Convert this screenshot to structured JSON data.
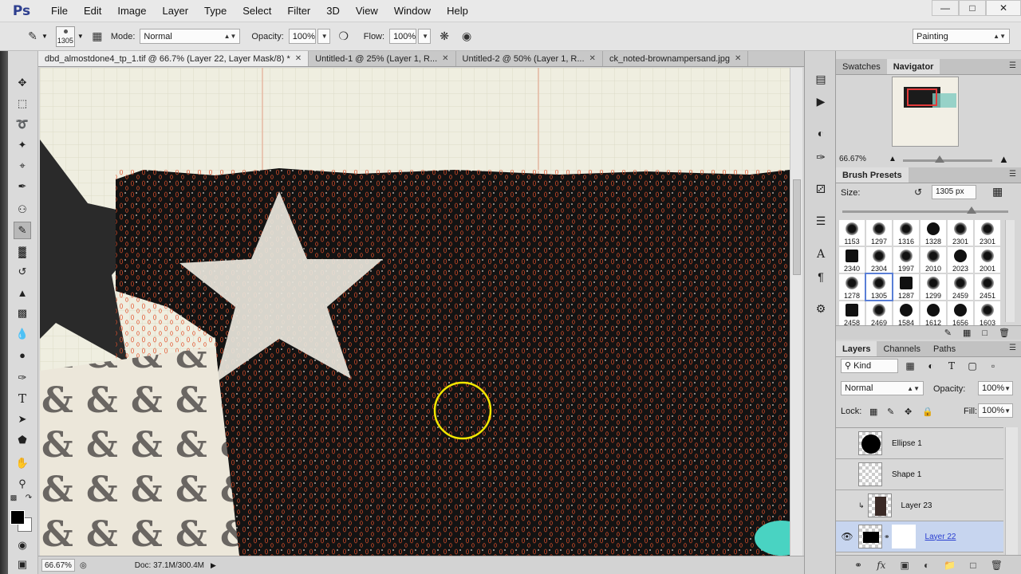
{
  "app": {
    "logo": "Ps",
    "menu": [
      "File",
      "Edit",
      "Image",
      "Layer",
      "Type",
      "Select",
      "Filter",
      "3D",
      "View",
      "Window",
      "Help"
    ],
    "window_controls": [
      "minimize-icon",
      "maximize-icon",
      "close-icon"
    ]
  },
  "options_bar": {
    "brush_size": "1305",
    "mode_label": "Mode:",
    "mode_value": "Normal",
    "opacity_label": "Opacity:",
    "opacity_value": "100%",
    "flow_label": "Flow:",
    "flow_value": "100%",
    "workspace_value": "Painting"
  },
  "tabs": [
    {
      "label": "dbd_almostdone4_tp_1.tif @ 66.7% (Layer 22, Layer Mask/8) *",
      "active": true
    },
    {
      "label": "Untitled-1 @ 25% (Layer 1, R...",
      "active": false
    },
    {
      "label": "Untitled-2 @ 50% (Layer 1, R...",
      "active": false
    },
    {
      "label": "ck_noted-brownampersand.jpg",
      "active": false
    }
  ],
  "status_bar": {
    "zoom": "66.67%",
    "doc": "Doc: 37.1M/300.4M"
  },
  "navigator": {
    "tabs": [
      "Swatches",
      "Navigator"
    ],
    "zoom": "66.67%"
  },
  "brush_presets": {
    "title": "Brush Presets",
    "size_label": "Size:",
    "size_value": "1305 px",
    "presets": [
      "1153",
      "1297",
      "1316",
      "1328",
      "2301",
      "2301",
      "2340",
      "2304",
      "1997",
      "2010",
      "2023",
      "2001",
      "1278",
      "1305",
      "1287",
      "1299",
      "2459",
      "2451",
      "2458",
      "2469",
      "1584",
      "1612",
      "1656",
      "1603"
    ]
  },
  "layers": {
    "tabs": [
      "Layers",
      "Channels",
      "Paths"
    ],
    "kind_label": "Kind",
    "blend_mode": "Normal",
    "opacity_label": "Opacity:",
    "opacity_value": "100%",
    "lock_label": "Lock:",
    "fill_label": "Fill:",
    "fill_value": "100%",
    "items": [
      {
        "name": "Ellipse 1",
        "visible": false,
        "selected": false
      },
      {
        "name": "Shape 1",
        "visible": false,
        "selected": false
      },
      {
        "name": "Layer 23",
        "visible": false,
        "selected": false
      },
      {
        "name": "Layer 22",
        "visible": true,
        "selected": true
      }
    ]
  },
  "colors": {
    "foreground": "#000000",
    "background": "#ffffff",
    "selection_accent": "#c7d5ef",
    "brush_cursor": "#f2e600",
    "mask_outline": "#e2502a"
  },
  "tool_icons": [
    "move-icon",
    "marquee-icon",
    "lasso-icon",
    "quick-select-icon",
    "crop-icon",
    "eyedropper-icon",
    "healing-icon",
    "brush-icon",
    "stamp-icon",
    "history-brush-icon",
    "eraser-icon",
    "gradient-icon",
    "blur-icon",
    "dodge-icon",
    "pen-icon",
    "type-icon",
    "path-select-icon",
    "shape-icon",
    "hand-icon",
    "zoom-icon"
  ]
}
